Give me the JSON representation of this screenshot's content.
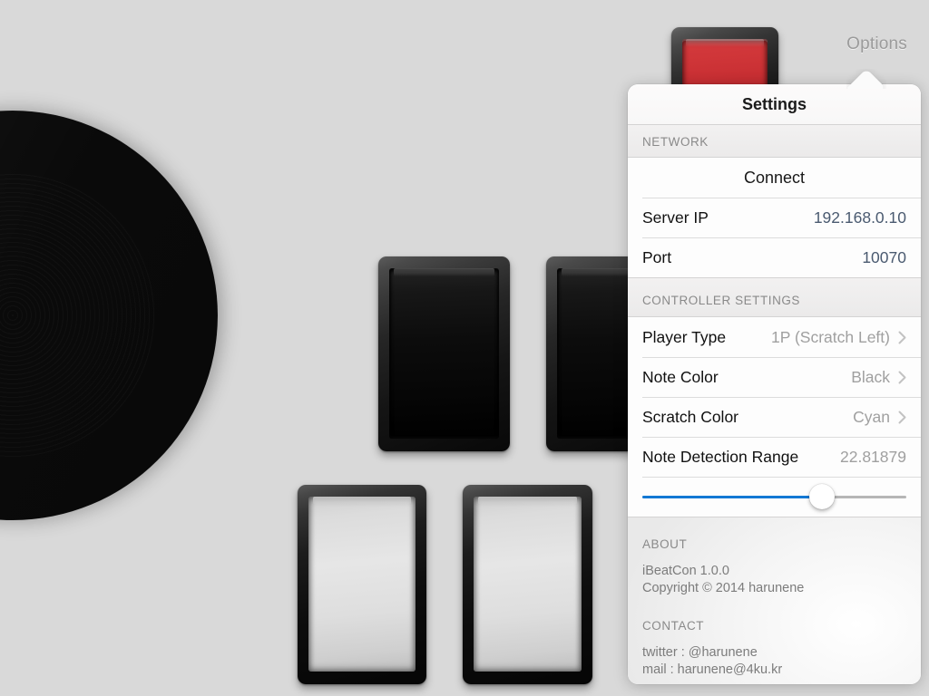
{
  "app": {
    "background_color": "#d9d9d9",
    "accent_color": "#1278d4",
    "options_label": "Options"
  },
  "pads": [
    {
      "name": "red-pad",
      "type": "red",
      "color": "#cf3538"
    },
    {
      "name": "black-pad-1",
      "type": "black",
      "color": "#0c0c0c"
    },
    {
      "name": "black-pad-2",
      "type": "black",
      "color": "#0c0c0c"
    },
    {
      "name": "white-pad-1",
      "type": "white",
      "color": "#e6e6e6"
    },
    {
      "name": "white-pad-2",
      "type": "white",
      "color": "#e6e6e6"
    }
  ],
  "turntable": {
    "name": "scratch-turntable",
    "vinyl_color": "#0a0a0a",
    "ring_color": "#93a8b9",
    "rim_color": "#979797"
  },
  "popover": {
    "title": "Settings",
    "sections": [
      {
        "header": "NETWORK",
        "rows": [
          {
            "kind": "action",
            "label": "Connect"
          },
          {
            "kind": "value",
            "label": "Server IP",
            "value": "192.168.0.10"
          },
          {
            "kind": "value",
            "label": "Port",
            "value": "10070"
          }
        ]
      },
      {
        "header": "CONTROLLER SETTINGS",
        "rows": [
          {
            "kind": "disclosure",
            "label": "Player Type",
            "value": "1P (Scratch Left)"
          },
          {
            "kind": "disclosure",
            "label": "Note Color",
            "value": "Black"
          },
          {
            "kind": "disclosure",
            "label": "Scratch Color",
            "value": "Cyan"
          },
          {
            "kind": "value-muted",
            "label": "Note Detection Range",
            "value": "22.81879"
          }
        ],
        "slider": {
          "name": "note-detection-range-slider",
          "percent": 68,
          "fill_color": "#1278d4",
          "track_color": "#b6b6b6"
        }
      }
    ],
    "about": {
      "header": "ABOUT",
      "line1": "iBeatCon 1.0.0",
      "line2": "Copyright © 2014 harunene"
    },
    "contact": {
      "header": "CONTACT",
      "line1": "twitter : @harunene",
      "line2": "mail : harunene@4ku.kr"
    }
  }
}
